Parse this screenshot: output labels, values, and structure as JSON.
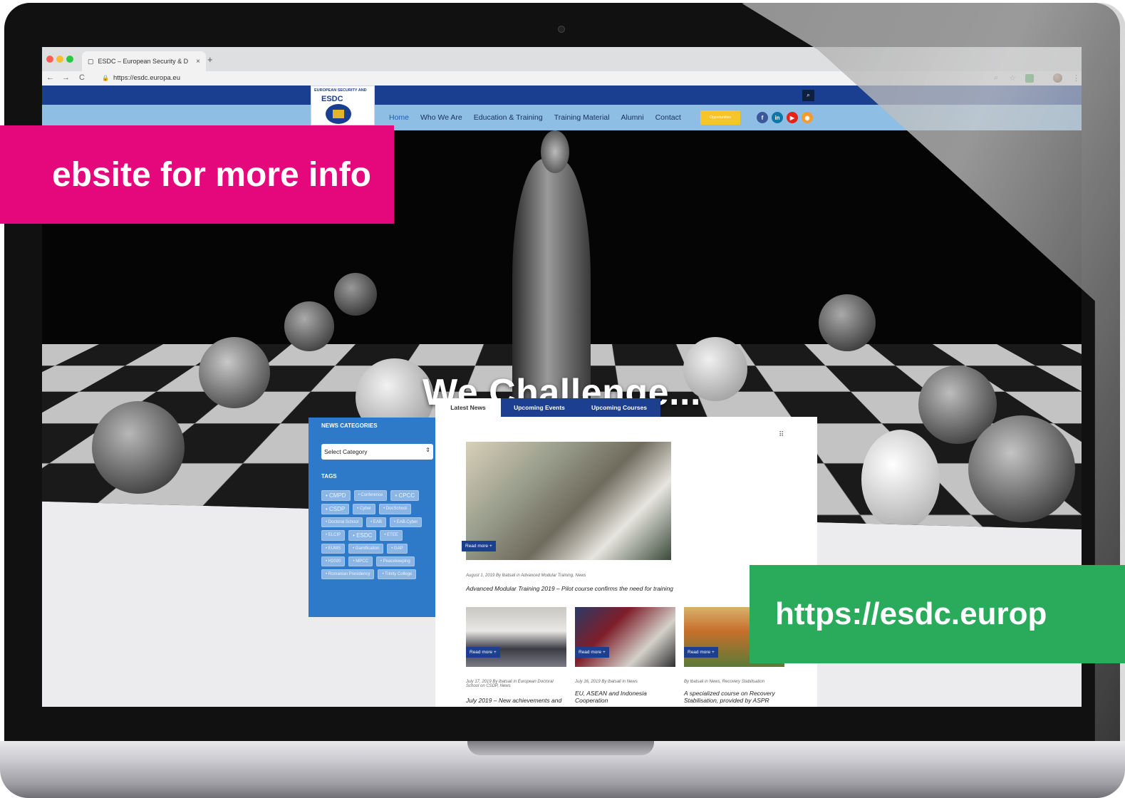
{
  "browser": {
    "tab_title": "ESDC – European Security & D",
    "tab_close": "×",
    "new_tab": "+",
    "url": "https://esdc.europa.eu",
    "back": "←",
    "forward": "→",
    "reload": "C"
  },
  "site": {
    "logo_line1": "EUROPEAN SECURITY AND",
    "logo_name": "ESDC",
    "nav": [
      "Home",
      "Who We Are",
      "Education & Training",
      "Training Material",
      "Alumni",
      "Contact"
    ],
    "opportunities": "Opportunities",
    "social": {
      "facebook": "f",
      "linkedin": "in",
      "youtube": "▶",
      "rss": "◉"
    }
  },
  "hero": {
    "title": "We Challenge..."
  },
  "sidebar": {
    "categories_heading": "NEWS CATEGORIES",
    "select_value": "Select Category",
    "tags_heading": "TAGS",
    "tags": [
      "CMPD",
      "Conference",
      "CPCC",
      "CSDP",
      "Cyber",
      "DocSchool",
      "Doctoral School",
      "EAB",
      "EAB.Cyber",
      "ELCIP",
      "ESDC",
      "ETEE",
      "EUMS",
      "Gamification",
      "GAP",
      "H2020",
      "MPCC",
      "Peacekeeping",
      "Romanian Presidency",
      "Trinity College"
    ]
  },
  "tabs": [
    "Latest News",
    "Upcoming Events",
    "Upcoming Courses"
  ],
  "news": {
    "read_more": "Read more +",
    "main": {
      "meta": "August 1, 2019 By lbatsali in Advanced Modular Training, News",
      "title": "Advanced Modular Training 2019 – Pilot course confirms the need for training"
    },
    "items": [
      {
        "meta": "July 17, 2019 By lbatsali in European Doctoral School on CSDP, News",
        "title": "July 2019 – New achievements and"
      },
      {
        "meta": "July 16, 2019 By lbatsali in News",
        "title": "EU, ASEAN and Indonesia Cooperation"
      },
      {
        "meta": "By lbatsali in News, Recovery Stabilisation",
        "title": "A specialized course on Recovery Stabilisation, provided by ASPR"
      }
    ]
  },
  "overlays": {
    "pink_banner": "ebsite for more info",
    "green_banner": "https://esdc.europ"
  },
  "colors": {
    "pink": "#e5087c",
    "green": "#2aab5c",
    "site_blue": "#1b3f90",
    "nav_light_blue": "#8fbee5"
  }
}
